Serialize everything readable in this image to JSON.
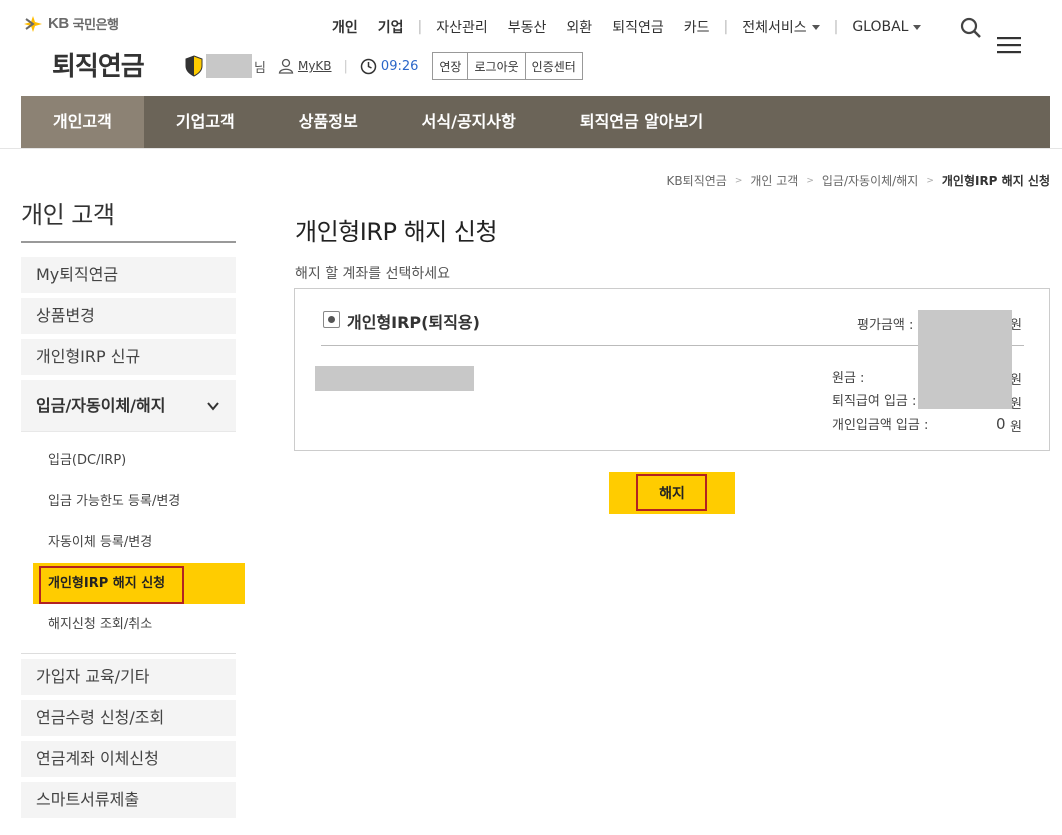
{
  "brand": {
    "kb": "KB",
    "bank": "국민은행",
    "site_title": "퇴직연금"
  },
  "user": {
    "suffix": "님",
    "mykb": "MyKB",
    "time": "09:26"
  },
  "session_buttons": [
    "연장",
    "로그아웃",
    "인증센터"
  ],
  "top_nav": {
    "personal": "개인",
    "corporate": "기업",
    "items": [
      "자산관리",
      "부동산",
      "외환",
      "퇴직연금",
      "카드"
    ],
    "all_services": "전체서비스",
    "global": "GLOBAL"
  },
  "gnb": [
    "개인고객",
    "기업고객",
    "상품정보",
    "서식/공지사항",
    "퇴직연금 알아보기"
  ],
  "breadcrumb": [
    "KB퇴직연금",
    "개인 고객",
    "입금/자동이체/해지",
    "개인형IRP 해지 신청"
  ],
  "sidebar": {
    "title": "개인 고객",
    "items_top": [
      "My퇴직연금",
      "상품변경",
      "개인형IRP 신규"
    ],
    "group_title": "입금/자동이체/해지",
    "sub_items": [
      "입금(DC/IRP)",
      "입금 가능한도 등록/변경",
      "자동이체 등록/변경",
      "개인형IRP 해지 신청",
      "해지신청 조회/취소"
    ],
    "items_bottom": [
      "가입자 교육/기타",
      "연금수령 신청/조회",
      "연금계좌 이체신청",
      "스마트서류제출"
    ]
  },
  "main": {
    "title": "개인형IRP 해지 신청",
    "instruction": "해지 할 계좌를 선택하세요",
    "account_name": "개인형IRP(퇴직용)",
    "eval_label": "평가금액 :",
    "won": "원",
    "principal_label": "원금 :",
    "severance_label": "퇴직급여 입금 :",
    "personal_label": "개인입금액 입금 :",
    "personal_value": "0",
    "cancel_button": "해지"
  }
}
